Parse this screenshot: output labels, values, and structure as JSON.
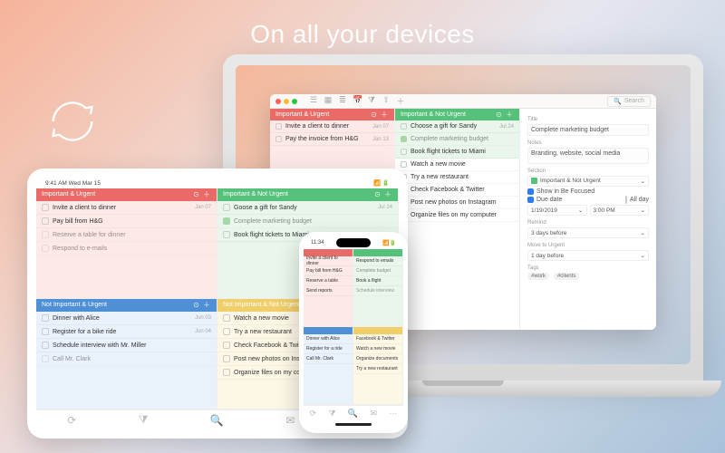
{
  "headline": "On all your devices",
  "colors": {
    "red": "#e96a66",
    "green": "#55c17a",
    "blue": "#4f8fd6",
    "yellow": "#f0ce69"
  },
  "quadrants": {
    "q1": {
      "title": "Important & Urgent"
    },
    "q2": {
      "title": "Important & Not Urgent"
    },
    "q3": {
      "title": "Not Important & Urgent"
    },
    "q4": {
      "title": "Not Important & Not Urgent"
    }
  },
  "mac": {
    "traffic": [
      "#ff5f57",
      "#febc2e",
      "#28c840"
    ],
    "search_placeholder": "Search",
    "q1_items": [
      {
        "text": "Invite a client to dinner",
        "date": "Jan 07"
      },
      {
        "text": "Pay the invoice from H&G",
        "date": "Jan 13"
      }
    ],
    "q2_items": [
      {
        "text": "Choose a gift for Sandy",
        "date": "Jul 24"
      },
      {
        "text": "Complete marketing budget",
        "done": true
      },
      {
        "text": "Book flight tickets to Miami"
      }
    ],
    "q3_items": [
      {
        "text": "Watch a new movie"
      },
      {
        "text": "Try a new restaurant"
      },
      {
        "text": "Check Facebook & Twitter"
      },
      {
        "text": "Post new photos on Instagram"
      },
      {
        "text": "Organize files on my computer"
      }
    ],
    "detail": {
      "title_label": "Title",
      "title_value": "Complete marketing budget",
      "notes_label": "Notes",
      "notes_value": "Branding, website, social media",
      "section_label": "Section",
      "section_value": "Important & Not Urgent",
      "show_in_label": "Show in Be Focused",
      "show_in_checked": true,
      "due_label": "Due date",
      "all_day_label": "All day",
      "due_checked": true,
      "due_date": "1/19/2019",
      "due_time": "3:00 PM",
      "remind_label": "Remind",
      "remind_value": "3 days before",
      "move_label": "Move to Urgent",
      "move_value": "1 day before",
      "tags_label": "Tags",
      "tags": [
        "#work",
        "#clients"
      ]
    }
  },
  "ipad": {
    "status_left": "9:41 AM  Wed Mar 15",
    "q1": {
      "items": [
        {
          "text": "Invite a client to dinner",
          "date": "Jan 07"
        },
        {
          "text": "Pay bill from H&G"
        },
        {
          "text": "Reserve a table for dinner",
          "muted": true
        },
        {
          "text": "Respond to e-mails",
          "muted": true
        }
      ]
    },
    "q2": {
      "items": [
        {
          "text": "Goose a gift for Sandy",
          "date": "Jul 24"
        },
        {
          "text": "Complete marketing budget",
          "done": true
        },
        {
          "text": "Book flight tickets to Miami"
        }
      ]
    },
    "q3": {
      "items": [
        {
          "text": "Dinner with Alice",
          "date": "Jun 03"
        },
        {
          "text": "Register for a bike ride",
          "date": "Jun 04"
        },
        {
          "text": "Schedule interview with Mr. Miller"
        },
        {
          "text": "Call Mr. Clark",
          "muted": true
        }
      ]
    },
    "q4": {
      "items": [
        {
          "text": "Watch a new movie"
        },
        {
          "text": "Try a new restaurant"
        },
        {
          "text": "Check Facebook & Twitter"
        },
        {
          "text": "Post new photos on Instagram"
        },
        {
          "text": "Organize files on my computer"
        }
      ]
    }
  },
  "iphone": {
    "status_time": "11:34",
    "q1": {
      "items": [
        {
          "text": "Invite a client to dinner"
        },
        {
          "text": "Pay bill from H&G"
        },
        {
          "text": "Reserve a table"
        },
        {
          "text": "Send reports"
        }
      ]
    },
    "q2": {
      "items": [
        {
          "text": "Respond to emails"
        },
        {
          "text": "Complete budget",
          "done": true
        },
        {
          "text": "Book a flight"
        },
        {
          "text": "Schedule interview",
          "muted": true
        }
      ]
    },
    "q3": {
      "items": [
        {
          "text": "Dinner with Alice"
        },
        {
          "text": "Register for a ride"
        },
        {
          "text": "Call Mr. Clark"
        }
      ]
    },
    "q4": {
      "items": [
        {
          "text": "Facebook & Twitter"
        },
        {
          "text": "Watch a new movie"
        },
        {
          "text": "Organize documents"
        },
        {
          "text": "Try a new restaurant"
        }
      ]
    }
  }
}
